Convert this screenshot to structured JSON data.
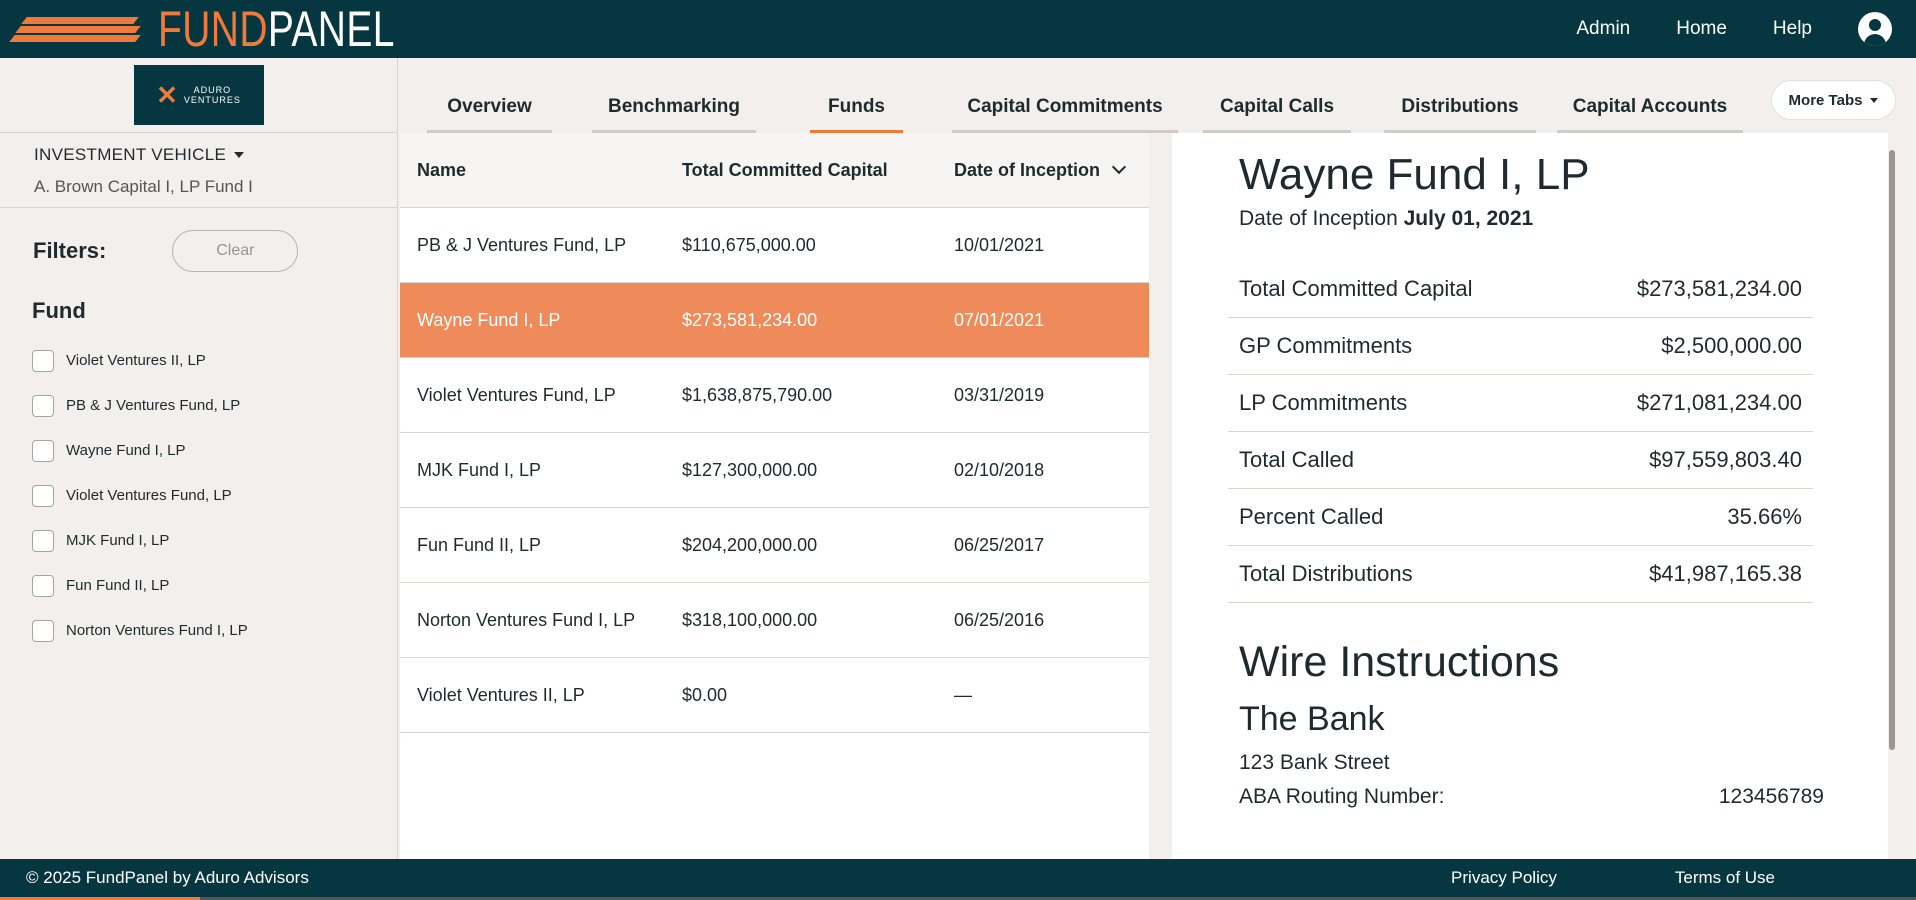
{
  "brand": {
    "name_part1": "FUND",
    "name_part2": "PANEL",
    "colors": {
      "primary": "#063740",
      "accent": "#ef7a3c",
      "selected_row": "#ef8a5a"
    }
  },
  "top_nav": {
    "admin": "Admin",
    "home": "Home",
    "help": "Help",
    "user_icon": "user-circle-icon"
  },
  "sidebar": {
    "client_logo": {
      "line1": "ADURO",
      "line2": "VENTURES"
    },
    "investment_vehicle_label": "INVESTMENT VEHICLE",
    "investment_vehicle_value": "A. Brown Capital I, LP Fund I",
    "filters_label": "Filters:",
    "clear_label": "Clear",
    "fund_heading": "Fund",
    "fund_filters": [
      "Violet Ventures II, LP",
      "PB & J Ventures Fund, LP",
      "Wayne Fund I, LP",
      "Violet Ventures Fund, LP",
      "MJK Fund I, LP",
      "Fun Fund II, LP",
      "Norton Ventures Fund I, LP"
    ]
  },
  "tabs": {
    "items": [
      "Overview",
      "Benchmarking",
      "Funds",
      "Capital Commitments",
      "Capital Calls",
      "Distributions",
      "Capital Accounts"
    ],
    "active": "Funds",
    "more_label": "More Tabs"
  },
  "table": {
    "headers": {
      "name": "Name",
      "committed": "Total Committed Capital",
      "inception": "Date of Inception"
    },
    "rows": [
      {
        "name": "PB & J Ventures Fund, LP",
        "committed": "$110,675,000.00",
        "inception": "10/01/2021",
        "selected": false
      },
      {
        "name": "Wayne Fund I, LP",
        "committed": "$273,581,234.00",
        "inception": "07/01/2021",
        "selected": true
      },
      {
        "name": "Violet Ventures Fund, LP",
        "committed": "$1,638,875,790.00",
        "inception": "03/31/2019",
        "selected": false
      },
      {
        "name": "MJK Fund I, LP",
        "committed": "$127,300,000.00",
        "inception": "02/10/2018",
        "selected": false
      },
      {
        "name": "Fun Fund II, LP",
        "committed": "$204,200,000.00",
        "inception": "06/25/2017",
        "selected": false
      },
      {
        "name": "Norton Ventures Fund I, LP",
        "committed": "$318,100,000.00",
        "inception": "06/25/2016",
        "selected": false
      },
      {
        "name": "Violet Ventures II, LP",
        "committed": "$0.00",
        "inception": "—",
        "selected": false
      }
    ]
  },
  "details": {
    "title": "Wayne Fund I, LP",
    "inception_label": "Date of Inception",
    "inception_value": "July 01, 2021",
    "metrics": [
      {
        "label": "Total Committed Capital",
        "value": "$273,581,234.00"
      },
      {
        "label": "GP Commitments",
        "value": "$2,500,000.00"
      },
      {
        "label": "LP Commitments",
        "value": "$271,081,234.00"
      },
      {
        "label": "Total Called",
        "value": "$97,559,803.40"
      },
      {
        "label": "Percent Called",
        "value": "35.66%"
      },
      {
        "label": "Total Distributions",
        "value": "$41,987,165.38"
      }
    ],
    "wire_title": "Wire Instructions",
    "bank_name": "The Bank",
    "bank_street": "123 Bank Street",
    "aba_label": "ABA Routing Number:",
    "aba_value": "123456789"
  },
  "footer": {
    "copyright": "© 2025 FundPanel by Aduro Advisors",
    "privacy": "Privacy Policy",
    "terms": "Terms of Use"
  }
}
